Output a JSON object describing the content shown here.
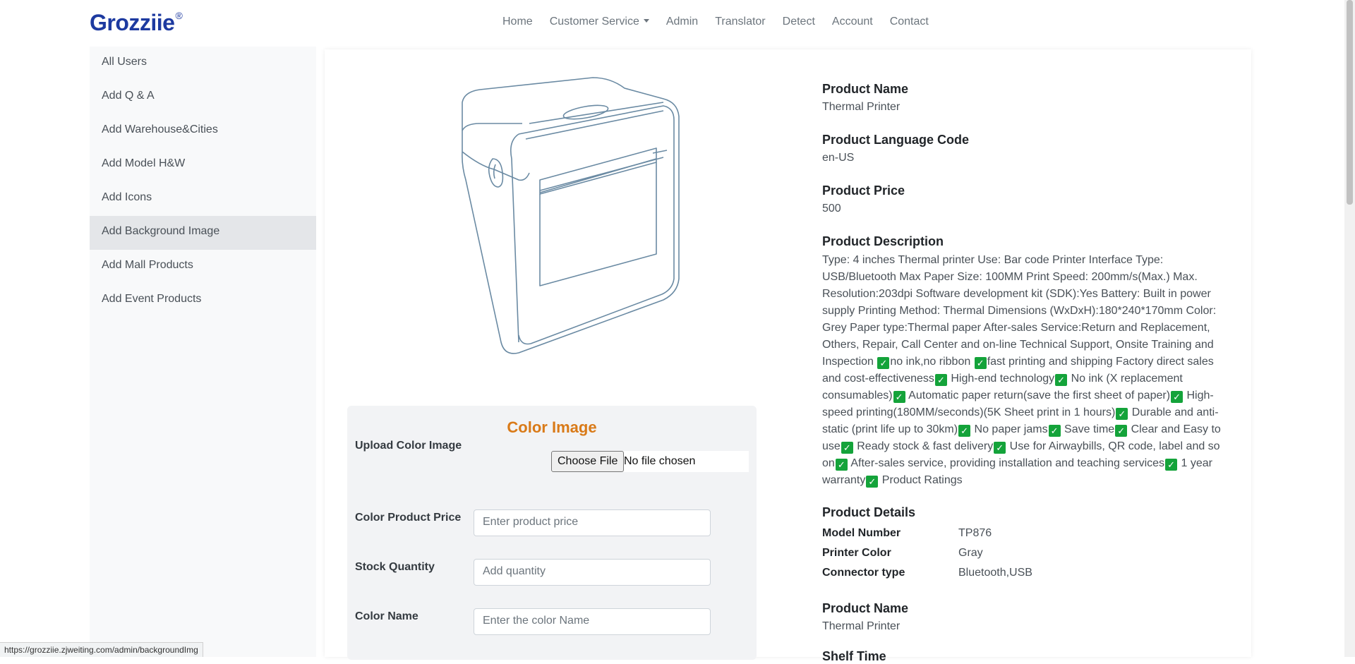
{
  "brand": {
    "name": "Grozziie",
    "mark": "®"
  },
  "nav": {
    "home": "Home",
    "customer_service": "Customer Service",
    "admin": "Admin",
    "translator": "Translator",
    "detect": "Detect",
    "account": "Account",
    "contact": "Contact"
  },
  "sidebar": {
    "items": [
      {
        "label": "All Users"
      },
      {
        "label": "Add Q & A"
      },
      {
        "label": "Add Warehouse&Cities"
      },
      {
        "label": "Add Model H&W"
      },
      {
        "label": "Add Icons"
      },
      {
        "label": "Add Background Image"
      },
      {
        "label": "Add Mall Products"
      },
      {
        "label": "Add Event Products"
      }
    ],
    "active_index": 5
  },
  "color_form": {
    "title": "Color Image",
    "upload_label": "Upload Color Image",
    "choose_file": "Choose File",
    "no_file": "No file chosen",
    "price_label": "Color Product Price",
    "price_placeholder": "Enter product price",
    "stock_label": "Stock Quantity",
    "stock_placeholder": "Add quantity",
    "color_name_label": "Color Name",
    "color_name_placeholder": "Enter the color Name"
  },
  "product": {
    "name_heading": "Product Name",
    "name": "Thermal Printer",
    "lang_heading": "Product Language Code",
    "lang": "en-US",
    "price_heading": "Product Price",
    "price": "500",
    "desc_heading": "Product Description",
    "desc_segments": [
      "Type: 4 inches Thermal printer Use: Bar code Printer Interface Type: USB/Bluetooth Max Paper Size: 100MM Print Speed: 200mm/s(Max.) Max. Resolution:203dpi Software development kit (SDK):Yes Battery: Built in power supply Printing Method: Thermal Dimensions (WxDxH):180*240*170mm Color: Grey Paper type:Thermal paper After-sales Service:Return and Replacement, Others, Repair, Call Center and on-line Technical Support, Onsite Training and Inspection ",
      "no ink,no ribbon ",
      "fast printing and shipping Factory direct sales and cost-effectiveness",
      " High-end technology",
      " No ink (X replacement consumables)",
      " Automatic paper return(save the first sheet of paper)",
      " High-speed printing(180MM/seconds)(5K Sheet print in 1 hours)",
      " Durable and anti-static (print life up to 30km)",
      " No paper jams",
      " Save time",
      " Clear and Easy to use",
      " Ready stock & fast delivery",
      " Use for Airwaybills, QR code, label and so on",
      " After-sales service, providing installation and teaching services",
      " 1 year warranty",
      " Product Ratings"
    ],
    "details_heading": "Product Details",
    "details": [
      {
        "label": "Model Number",
        "value": "TP876"
      },
      {
        "label": "Printer Color",
        "value": "Gray"
      },
      {
        "label": "Connector type",
        "value": "Bluetooth,USB"
      }
    ],
    "name_heading_2": "Product Name",
    "name_2": "Thermal Printer",
    "shelf_heading": "Shelf Time"
  },
  "status_url": "https://grozziie.zjweiting.com/admin/backgroundImg",
  "colors": {
    "brand": "#1d3aa0",
    "accent": "#d97a18",
    "check": "#14a33a"
  }
}
